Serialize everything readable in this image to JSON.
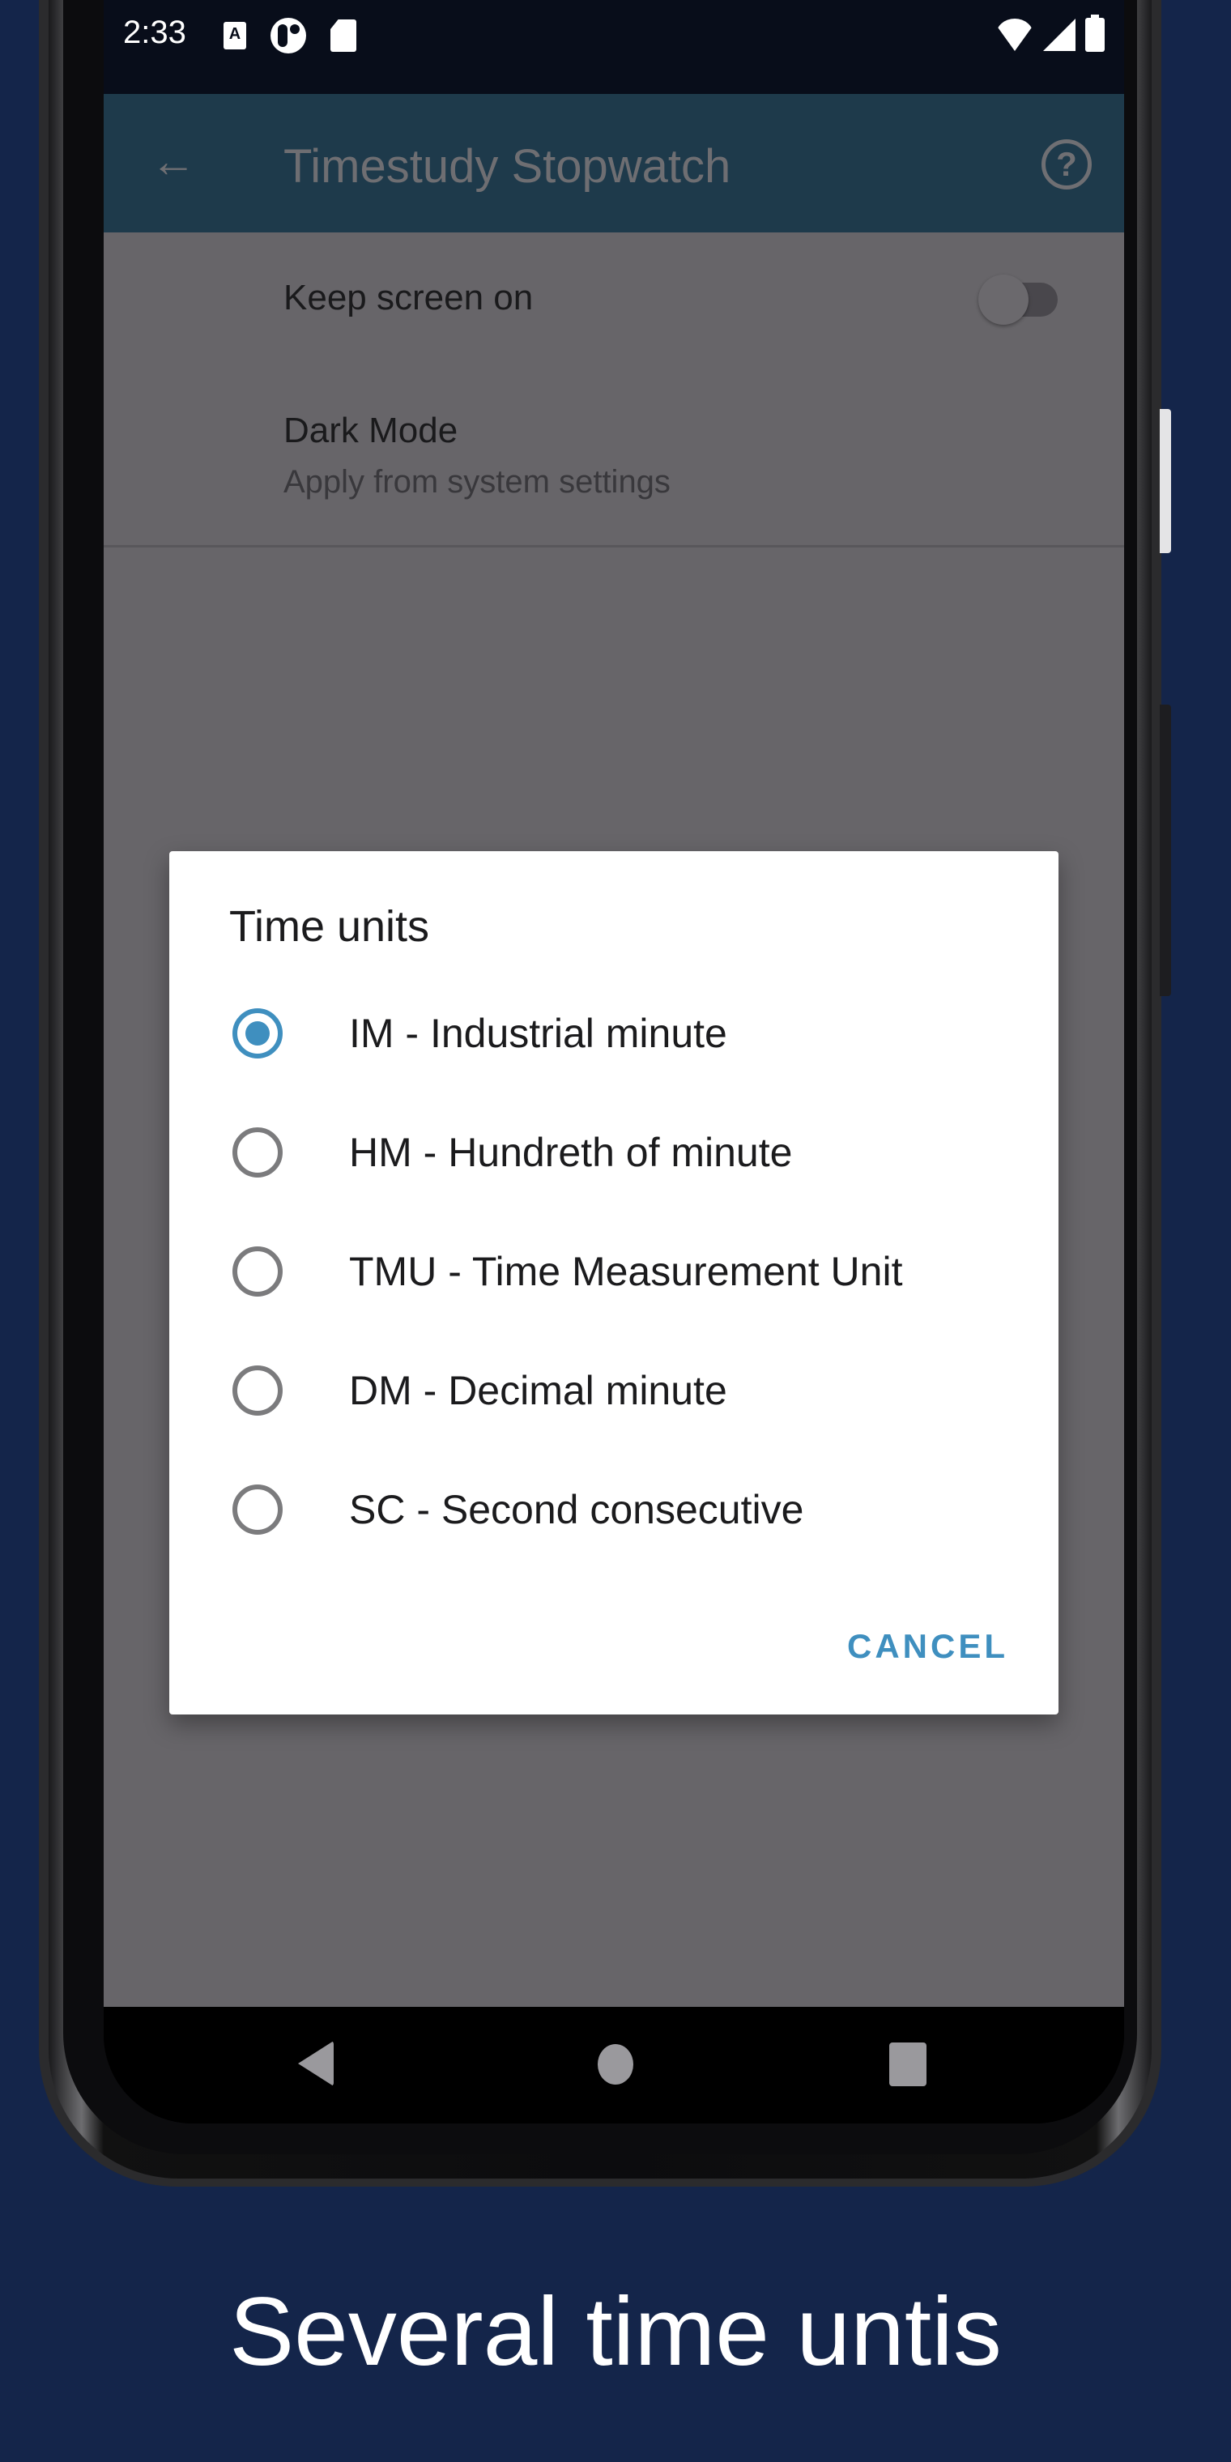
{
  "status_bar": {
    "time": "2:33",
    "left_icons": [
      "accessibility-a-icon",
      "notification-o-icon",
      "sd-card-icon"
    ],
    "right_icons": [
      "wifi-icon",
      "cell-signal-icon",
      "battery-icon"
    ],
    "a_glyph": "A"
  },
  "app_bar": {
    "title": "Timestudy Stopwatch",
    "back_glyph": "←",
    "help_glyph": "?"
  },
  "settings": {
    "keep_screen_on": {
      "label": "Keep screen on",
      "enabled": false
    },
    "dark_mode": {
      "label": "Dark Mode",
      "summary": "Apply from system settings"
    }
  },
  "dialog": {
    "title": "Time units",
    "options": [
      {
        "label": "IM - Industrial minute",
        "selected": true
      },
      {
        "label": "HM - Hundreth of minute",
        "selected": false
      },
      {
        "label": "TMU - Time Measurement Unit",
        "selected": false
      },
      {
        "label": "DM - Decimal minute",
        "selected": false
      },
      {
        "label": "SC - Second consecutive",
        "selected": false
      }
    ],
    "cancel_label": "CANCEL"
  },
  "colors": {
    "accent": "#3f8fbf",
    "background": "#14254a",
    "app_bar": "#1e3a4b",
    "scrim_content": "#676569"
  },
  "caption": "Several time untis"
}
